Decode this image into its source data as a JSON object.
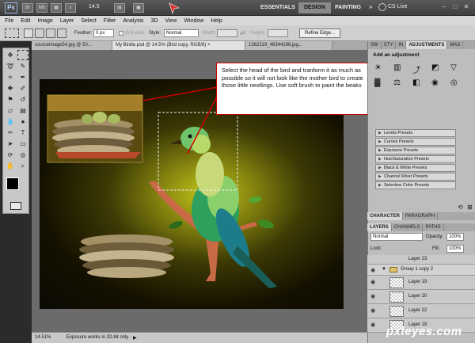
{
  "app": {
    "logo": "Ps",
    "zoom": "14.5",
    "workspaces": [
      "ESSENTIALS",
      "DESIGN",
      "PAINTING"
    ],
    "active_workspace": "DESIGN",
    "cs_live": "CS Live"
  },
  "menu": [
    "File",
    "Edit",
    "Image",
    "Layer",
    "Select",
    "Filter",
    "Analysis",
    "3D",
    "View",
    "Window",
    "Help"
  ],
  "options": {
    "feather_label": "Feather:",
    "feather_value": "0 px",
    "antialias_label": "Anti-alias",
    "style_label": "Style:",
    "style_value": "Normal",
    "width_label": "Width:",
    "height_label": "Height:",
    "refine_edge": "Refine Edge..."
  },
  "tabs": [
    "sourceimage54.jpg @ 50...",
    "My Birdie.psd @ 14.5% (Bird copy, RGB/8) ×",
    "1362219_46344198.jpg..."
  ],
  "callout": "Select the head of the bird and tranform it as much as possible so it will not look like the mother bird to create those little nestlings. Use soft brush to paint the beaks",
  "status": {
    "zoom": "14.51%",
    "message": "Exposure works in 32-bit only"
  },
  "panels": {
    "top_tabs": [
      "SW",
      "STY",
      "IN",
      "ADJUSTMENTS",
      "MAS"
    ],
    "adjust_title": "Add an adjustment",
    "presets": [
      "Levels Presets",
      "Curves Presets",
      "Exposure Presets",
      "Hue/Saturation Presets",
      "Black & White Presets",
      "Channel Mixer Presets",
      "Selective Color Presets"
    ],
    "char_tabs": [
      "CHARACTER",
      "PARAGRAPH"
    ],
    "layer_tabs": [
      "LAYERS",
      "CHANNELS",
      "PATHS"
    ],
    "blend_mode": "Normal",
    "opacity_label": "Opacity:",
    "opacity_value": "100%",
    "lock_label": "Lock:",
    "fill_label": "Fill:",
    "fill_value": "100%",
    "layers": [
      "Layer 23",
      "Group 1 copy 2",
      "Layer 19",
      "Layer 20",
      "Layer 22",
      "Layer 18"
    ]
  },
  "watermark": "pxleyes.com"
}
